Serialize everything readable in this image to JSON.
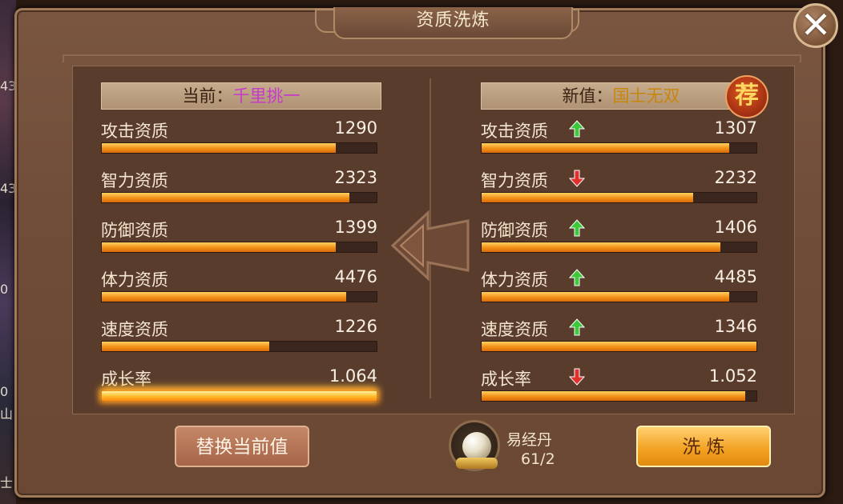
{
  "dialog": {
    "title": "资质洗炼"
  },
  "background_strip": [
    "43",
    "43",
    "0",
    "0",
    "山",
    "士"
  ],
  "current": {
    "label": "当前：",
    "grade": "千里挑一",
    "stats": [
      {
        "name": "攻击资质",
        "value": "1290",
        "fill": 0.85
      },
      {
        "name": "智力资质",
        "value": "2323",
        "fill": 0.9
      },
      {
        "name": "防御资质",
        "value": "1399",
        "fill": 0.85
      },
      {
        "name": "体力资质",
        "value": "4476",
        "fill": 0.89
      },
      {
        "name": "速度资质",
        "value": "1226",
        "fill": 0.61
      },
      {
        "name": "成长率",
        "value": "1.064",
        "fill": 1.0
      }
    ]
  },
  "new": {
    "label": "新值：",
    "grade": "国士无双",
    "recommend_badge": "荐",
    "stats": [
      {
        "name": "攻击资质",
        "value": "1307",
        "trend": "up",
        "fill": 0.9
      },
      {
        "name": "智力资质",
        "value": "2232",
        "trend": "down",
        "fill": 0.77
      },
      {
        "name": "防御资质",
        "value": "1406",
        "trend": "up",
        "fill": 0.87
      },
      {
        "name": "体力资质",
        "value": "4485",
        "trend": "up",
        "fill": 0.9
      },
      {
        "name": "速度资质",
        "value": "1346",
        "trend": "up",
        "fill": 1.0
      },
      {
        "name": "成长率",
        "value": "1.052",
        "trend": "down",
        "fill": 0.96
      }
    ]
  },
  "actions": {
    "replace_label": "替换当前值",
    "refine_label": "洗 炼"
  },
  "item": {
    "name": "易经丹",
    "count": "61/2",
    "icon": "pearl-icon"
  },
  "colors": {
    "up": "#3ec83a",
    "down": "#e03030",
    "current_grade": "#c53ac8",
    "new_grade": "#c8860a"
  }
}
